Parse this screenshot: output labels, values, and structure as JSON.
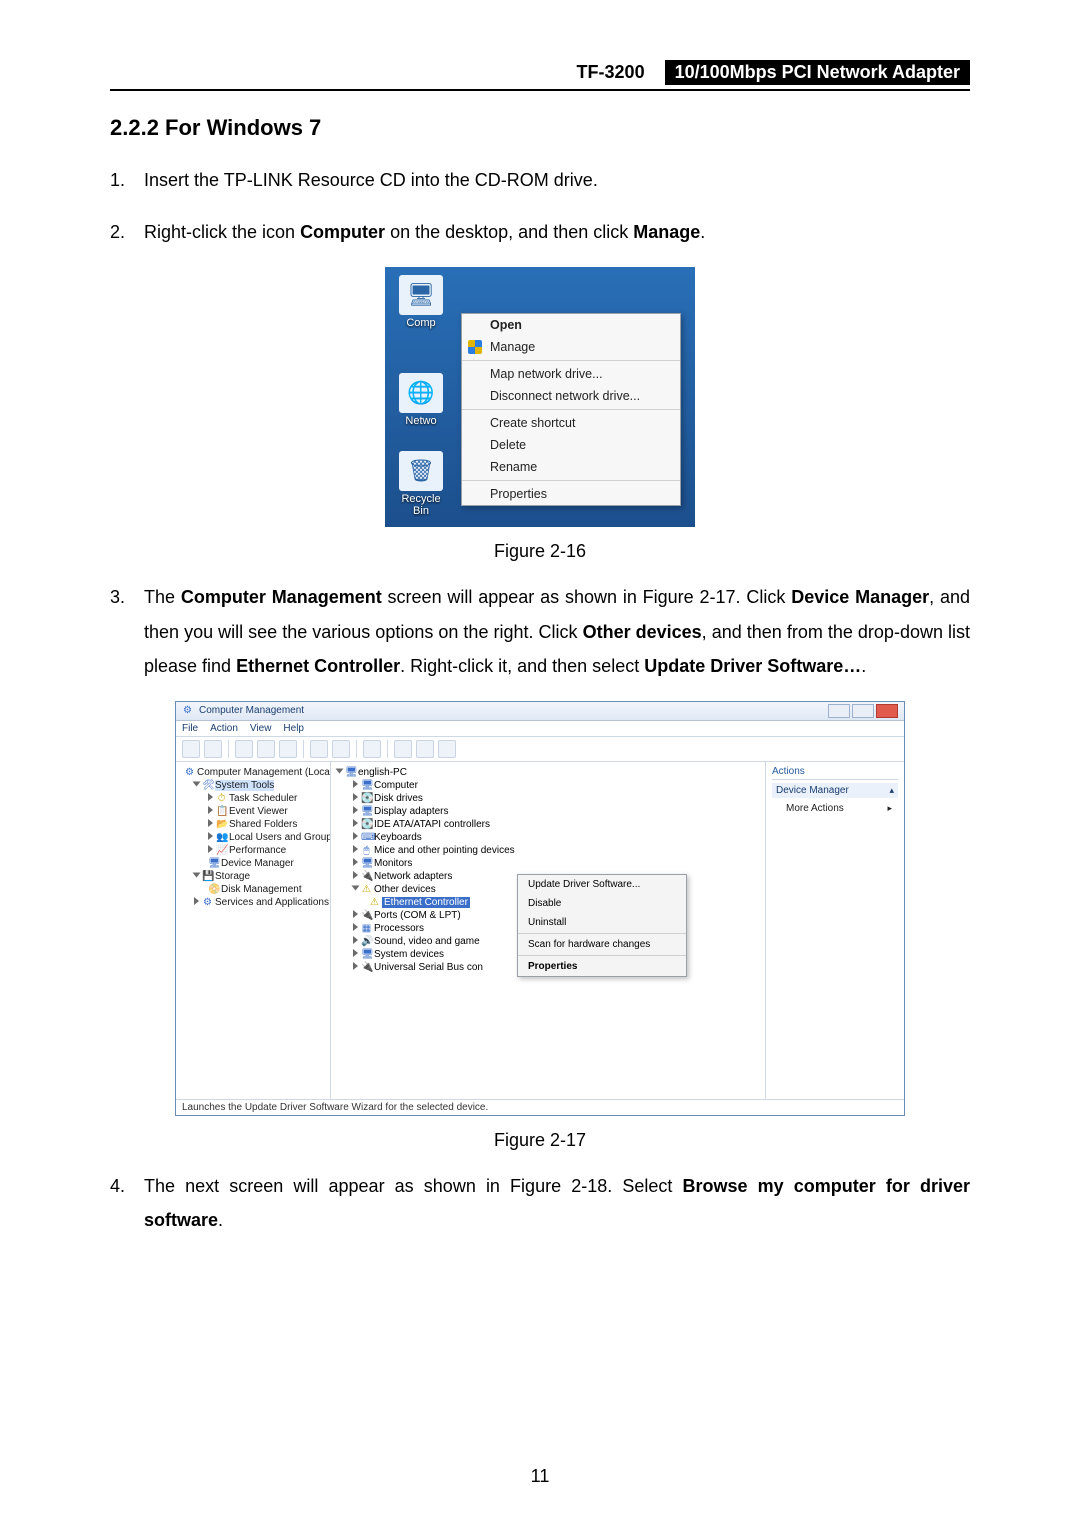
{
  "header": {
    "model": "TF-3200",
    "name": "10/100Mbps PCI Network Adapter"
  },
  "section_title": "2.2.2  For Windows 7",
  "steps": {
    "s1": "Insert the TP-LINK Resource CD into the CD-ROM drive.",
    "s2_a": "Right-click the icon ",
    "s2_b": "Computer",
    "s2_c": " on the desktop, and then click ",
    "s2_d": "Manage",
    "s2_e": ".",
    "s3_a": "The ",
    "s3_b": "Computer Management",
    "s3_c": " screen will appear as shown in Figure 2-17. Click ",
    "s3_d": "Device Manager",
    "s3_e": ", and then you will see the various options on the right. Click ",
    "s3_f": "Other devices",
    "s3_g": ", and then from the drop-down list please find ",
    "s3_h": "Ethernet Controller",
    "s3_i": ". Right-click it, and then select ",
    "s3_j": "Update Driver Software…",
    "s3_k": ".",
    "s4_a": "The next screen will appear as shown in Figure 2-18. Select ",
    "s4_b": "Browse my computer for driver software",
    "s4_c": "."
  },
  "fig16_caption": "Figure 2-16",
  "fig17_caption": "Figure 2-17",
  "page_number": "11",
  "desktop": {
    "icons": [
      {
        "label": "Comp",
        "glyph": "🖥"
      },
      {
        "label": "Netwo",
        "glyph": "🌐"
      },
      {
        "label": "Recycle Bin",
        "glyph": "🗑"
      }
    ],
    "context_menu": [
      {
        "label": "Open",
        "bold": true
      },
      {
        "label": "Manage",
        "shield": true
      },
      "---",
      {
        "label": "Map network drive..."
      },
      {
        "label": "Disconnect network drive..."
      },
      "---",
      {
        "label": "Create shortcut"
      },
      {
        "label": "Delete"
      },
      {
        "label": "Rename"
      },
      "---",
      {
        "label": "Properties"
      }
    ]
  },
  "mgmt": {
    "title": "Computer Management",
    "menu": [
      "File",
      "Action",
      "View",
      "Help"
    ],
    "left_tree": {
      "root": "Computer Management (Local",
      "groups": [
        {
          "label": "System Tools",
          "open": true,
          "sel": true,
          "children": [
            "Task Scheduler",
            "Event Viewer",
            "Shared Folders",
            "Local Users and Groups",
            "Performance",
            "Device Manager"
          ]
        },
        {
          "label": "Storage",
          "open": true,
          "children": [
            "Disk Management"
          ]
        },
        {
          "label": "Services and Applications",
          "open": false,
          "children": []
        }
      ]
    },
    "center_tree": {
      "root": "english-PC",
      "nodes": [
        "Computer",
        "Disk drives",
        "Display adapters",
        "IDE ATA/ATAPI controllers",
        "Keyboards",
        "Mice and other pointing devices",
        "Monitors",
        "Network adapters"
      ],
      "other_devices": {
        "label": "Other devices",
        "child": "Ethernet Controller"
      },
      "after": [
        "Ports (COM & LPT)",
        "Processors",
        "Sound, video and game",
        "System devices",
        "Universal Serial Bus con"
      ]
    },
    "ctx2": [
      "Update Driver Software...",
      "Disable",
      "Uninstall",
      "---",
      "Scan for hardware changes",
      "---",
      "Properties"
    ],
    "right": {
      "heading": "Actions",
      "sub": "Device Manager",
      "action": "More Actions"
    },
    "status": "Launches the Update Driver Software Wizard for the selected device."
  }
}
